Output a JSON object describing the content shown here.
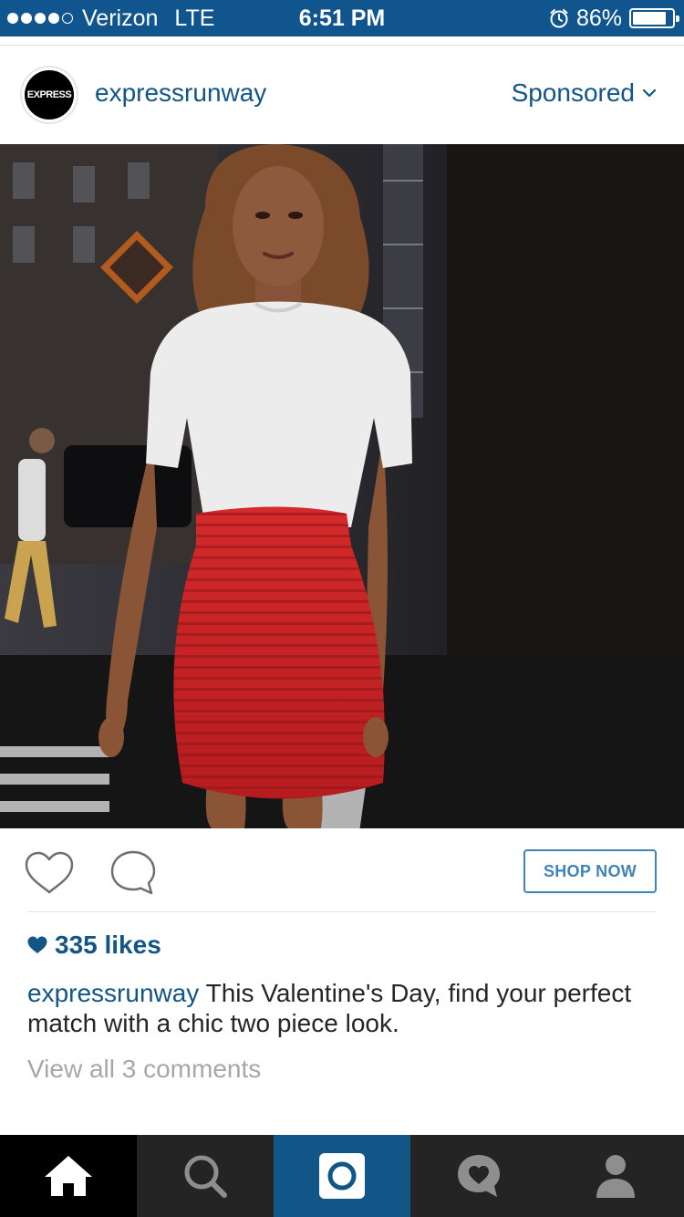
{
  "status_bar": {
    "carrier": "Verizon",
    "network": "LTE",
    "time": "6:51 PM",
    "battery": "86%",
    "battery_level": 0.86,
    "signal_bars_filled": 4,
    "signal_bars_total": 5
  },
  "post": {
    "avatar_text": "EXPRESS",
    "username": "expressrunway",
    "sponsored_label": "Sponsored",
    "shop_now_label": "SHOP NOW",
    "likes_text": "335 likes",
    "caption_user": "expressrunway",
    "caption_text": " This Valentine's Day, find your perfect match with a chic two piece look.",
    "view_comments_label": "View all 3 comments"
  },
  "tabs": [
    {
      "icon": "home-icon",
      "active": true
    },
    {
      "icon": "search-icon",
      "active": false
    },
    {
      "icon": "camera-icon",
      "active": false
    },
    {
      "icon": "activity-icon",
      "active": false
    },
    {
      "icon": "profile-icon",
      "active": false
    }
  ],
  "colors": {
    "status_bar": "#11558f",
    "link_blue": "#125688",
    "shop_now_border": "#3f83b7",
    "tab_bar": "#242424",
    "tab_camera": "#125688",
    "skirt_red": "#c82224"
  }
}
